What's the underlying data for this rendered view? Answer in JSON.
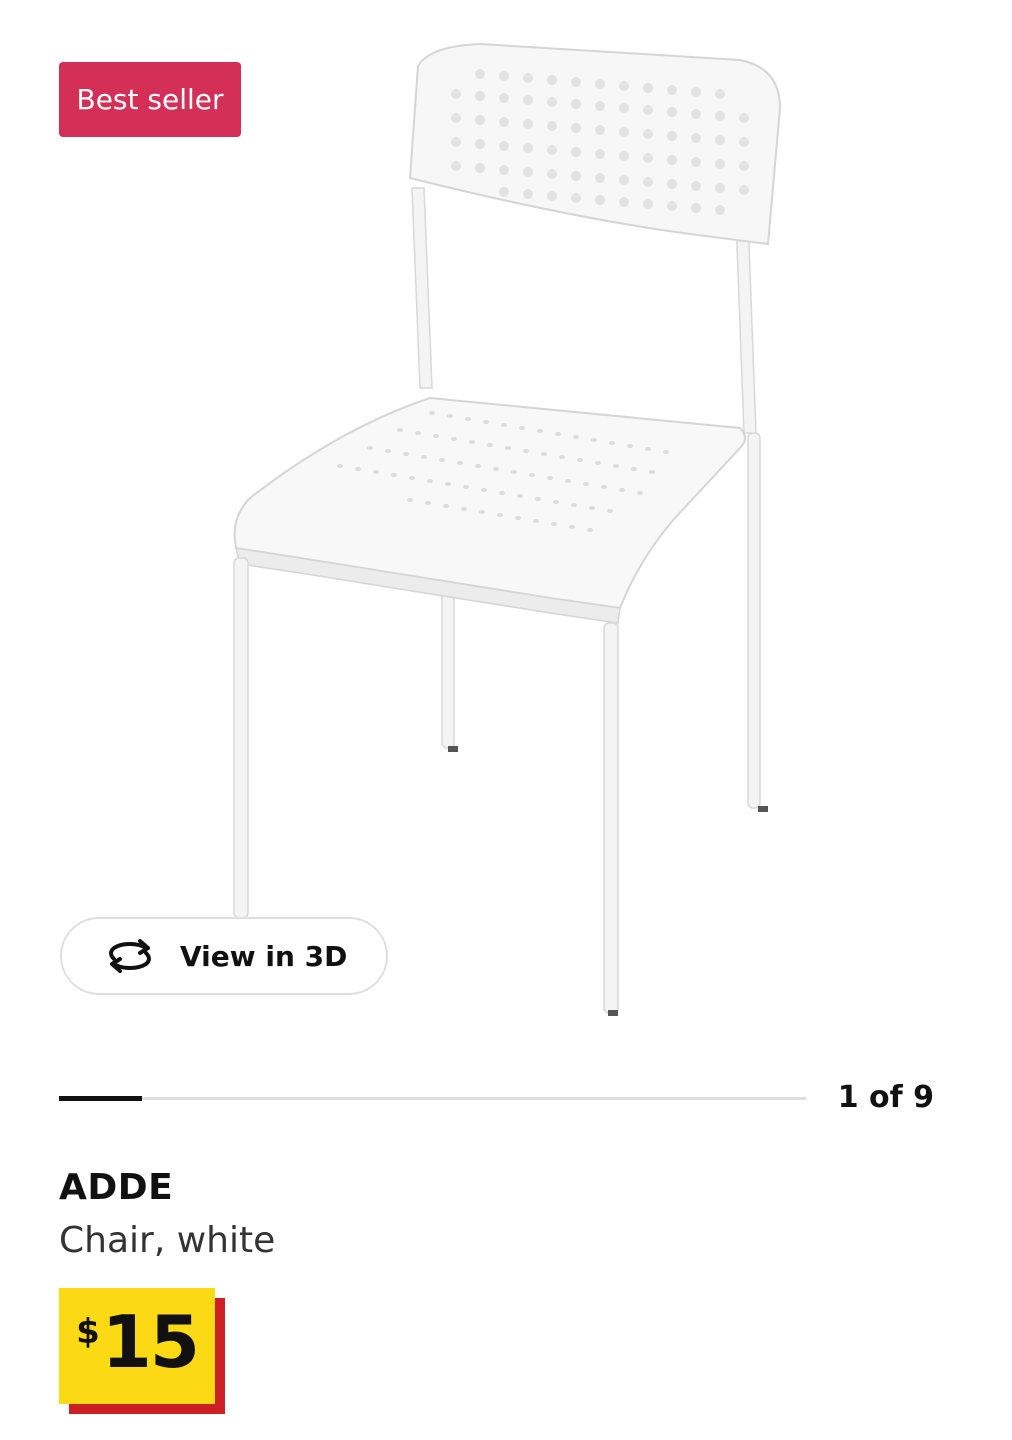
{
  "badge": {
    "label": "Best seller",
    "color": "#d42f57"
  },
  "gallery": {
    "image_subject": "chair-image",
    "view3d_label": "View in 3D",
    "view3d_icon": "rotate-3d-icon",
    "current_index": 1,
    "total": 9,
    "pager_text": "1 of 9",
    "progress_fraction": 0.111
  },
  "product": {
    "name": "ADDE",
    "description": "Chair, white",
    "price_currency": "$",
    "price_amount": "15",
    "price_bg_color": "#fbd914",
    "price_shadow_color": "#cc1f26"
  }
}
